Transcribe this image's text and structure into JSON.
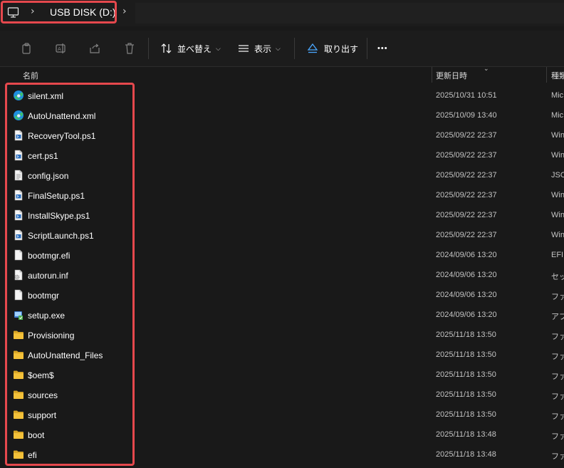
{
  "addressbar": {
    "location_icon": "computer-icon",
    "path": "USB DISK (D:)"
  },
  "toolbar": {
    "copy_icon": "copy-icon",
    "rename_icon": "rename-icon",
    "share_icon": "share-icon",
    "delete_icon": "trash-icon",
    "sort_label": "並べ替え",
    "view_label": "表示",
    "eject_label": "取り出す",
    "more_label": "•••"
  },
  "columns": {
    "name": "名前",
    "modified": "更新日時",
    "type": "種類"
  },
  "files": [
    {
      "name": "silent.xml",
      "icon": "edge-icon",
      "modified": "2025/10/31 10:51",
      "type": "Mic"
    },
    {
      "name": "AutoUnattend.xml",
      "icon": "edge-icon",
      "modified": "2025/10/09 13:40",
      "type": "Mic"
    },
    {
      "name": "RecoveryTool.ps1",
      "icon": "powershell-script-icon",
      "modified": "2025/09/22 22:37",
      "type": "Win"
    },
    {
      "name": "cert.ps1",
      "icon": "powershell-script-icon",
      "modified": "2025/09/22 22:37",
      "type": "Win"
    },
    {
      "name": "config.json",
      "icon": "text-file-icon",
      "modified": "2025/09/22 22:37",
      "type": "JSO"
    },
    {
      "name": "FinalSetup.ps1",
      "icon": "powershell-script-icon",
      "modified": "2025/09/22 22:37",
      "type": "Win"
    },
    {
      "name": "InstallSkype.ps1",
      "icon": "powershell-script-icon",
      "modified": "2025/09/22 22:37",
      "type": "Win"
    },
    {
      "name": "ScriptLaunch.ps1",
      "icon": "powershell-script-icon",
      "modified": "2025/09/22 22:37",
      "type": "Win"
    },
    {
      "name": "bootmgr.efi",
      "icon": "blank-file-icon",
      "modified": "2024/09/06 13:20",
      "type": "EFI"
    },
    {
      "name": "autorun.inf",
      "icon": "settings-file-icon",
      "modified": "2024/09/06 13:20",
      "type": "セッ"
    },
    {
      "name": "bootmgr",
      "icon": "blank-file-icon",
      "modified": "2024/09/06 13:20",
      "type": "ファ"
    },
    {
      "name": "setup.exe",
      "icon": "installer-icon",
      "modified": "2024/09/06 13:20",
      "type": "アプ"
    },
    {
      "name": "Provisioning",
      "icon": "folder-icon",
      "modified": "2025/11/18 13:50",
      "type": "ファ"
    },
    {
      "name": "AutoUnattend_Files",
      "icon": "folder-icon",
      "modified": "2025/11/18 13:50",
      "type": "ファ"
    },
    {
      "name": "$oem$",
      "icon": "folder-icon",
      "modified": "2025/11/18 13:50",
      "type": "ファ"
    },
    {
      "name": "sources",
      "icon": "folder-icon",
      "modified": "2025/11/18 13:50",
      "type": "ファ"
    },
    {
      "name": "support",
      "icon": "folder-icon",
      "modified": "2025/11/18 13:50",
      "type": "ファ"
    },
    {
      "name": "boot",
      "icon": "folder-icon",
      "modified": "2025/11/18 13:48",
      "type": "ファ"
    },
    {
      "name": "efi",
      "icon": "folder-icon",
      "modified": "2025/11/18 13:48",
      "type": "ファ"
    }
  ],
  "colors": {
    "background": "#191919",
    "highlight": "#e5484d",
    "folder": "#f3c13a",
    "edge_blue": "#1f8fe0",
    "edge_green": "#3ec26e"
  }
}
